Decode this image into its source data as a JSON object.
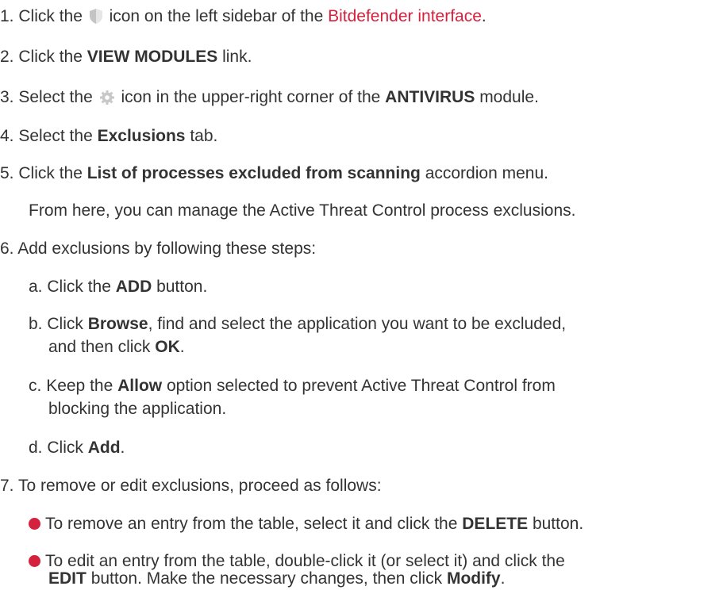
{
  "colors": {
    "text": "#333333",
    "link": "#d4213d",
    "bullet": "#d4213d",
    "icon_gray": "#bfbfbf"
  },
  "steps": {
    "s1": {
      "num": "1.",
      "pre": "Click the",
      "icon": "shield-icon",
      "mid": "icon on the left sidebar of the",
      "link": "Bitdefender interface",
      "post": "."
    },
    "s2": {
      "num": "2.",
      "pre": "Click the",
      "bold": "VIEW MODULES",
      "post": "link."
    },
    "s3": {
      "num": "3.",
      "pre": "Select the",
      "icon": "gear-icon",
      "mid": "icon in the upper-right corner of the",
      "bold": "ANTIVIRUS",
      "post": "module."
    },
    "s4": {
      "num": "4.",
      "pre": "Select the",
      "bold": "Exclusions",
      "post": "tab."
    },
    "s5": {
      "num": "5.",
      "pre": "Click the",
      "bold": "List of processes excluded from scanning",
      "post": "accordion menu."
    },
    "s5_note": "From here, you can manage the Active Threat Control process exclusions.",
    "s6": {
      "num": "6.",
      "text": "Add exclusions by following these steps:"
    },
    "s6a": {
      "num": "a.",
      "pre": "Click the",
      "bold": "ADD",
      "post": "button."
    },
    "s6b": {
      "num": "b.",
      "pre": "Click",
      "bold1": "Browse",
      "mid": ", find and select the application you want to be excluded,",
      "cont_pre": "and then click",
      "bold2": "OK",
      "cont_post": "."
    },
    "s6c": {
      "num": "c.",
      "pre": "Keep the",
      "bold": "Allow",
      "post": "option selected to prevent Active Threat Control from",
      "cont": "blocking the application."
    },
    "s6d": {
      "num": "d.",
      "pre": "Click",
      "bold": "Add",
      "post": "."
    },
    "s7": {
      "num": "7.",
      "text": "To remove or edit exclusions, proceed as follows:"
    },
    "s7_b1": {
      "pre": "To remove an entry from the table, select it and click the",
      "bold": "DELETE",
      "post": "button."
    },
    "s7_b2": {
      "pre": "To edit an entry from the table, double-click it (or select it) and click the",
      "bold1": "EDIT",
      "mid": "button. Make the necessary changes, then click",
      "bold2": "Modify",
      "post": "."
    }
  }
}
